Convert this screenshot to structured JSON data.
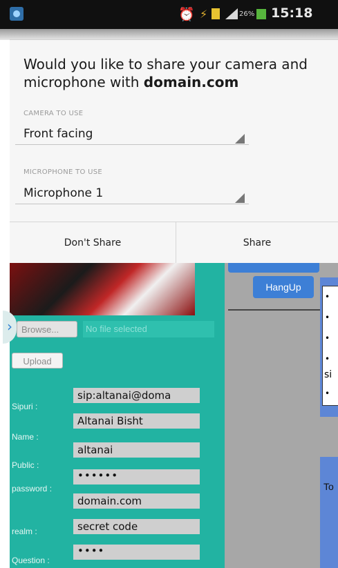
{
  "status_bar": {
    "app_icon": "app-notification-icon",
    "alarm_icon": "alarm-clock-icon",
    "usb_icon": "usb-icon",
    "note_icon": "notification-icon",
    "signal_icon": "signal-icon",
    "battery": "26%",
    "time": "15:18"
  },
  "dialog": {
    "title_prefix": "Would you like to share your camera and microphone with",
    "title_domain": "domain.com",
    "camera_label": "CAMERA TO USE",
    "camera_value": "Front facing",
    "mic_label": "MICROPHONE TO USE",
    "mic_value": "Microphone 1",
    "dont_share": "Don't Share",
    "share": "Share"
  },
  "page": {
    "hangup_label": "HangUp",
    "browse_label": "Browse...",
    "no_file": "No file selected",
    "upload_label": "Upload",
    "list_bullets": [
      "•",
      "•",
      "•",
      "•",
      "•"
    ],
    "list_partial": "si",
    "to_label": "To",
    "fields": [
      {
        "label": "Sipuri :",
        "value": "sip:altanai@doma"
      },
      {
        "label": "Name :",
        "value": "Altanai Bisht"
      },
      {
        "label": "Public :",
        "value": "altanai"
      },
      {
        "label": "password :",
        "value": "••••••"
      },
      {
        "label": "realm :",
        "value": "domain.com"
      },
      {
        "label": "Question :",
        "value": "secret code"
      },
      {
        "label": "",
        "value": "••••"
      }
    ]
  }
}
